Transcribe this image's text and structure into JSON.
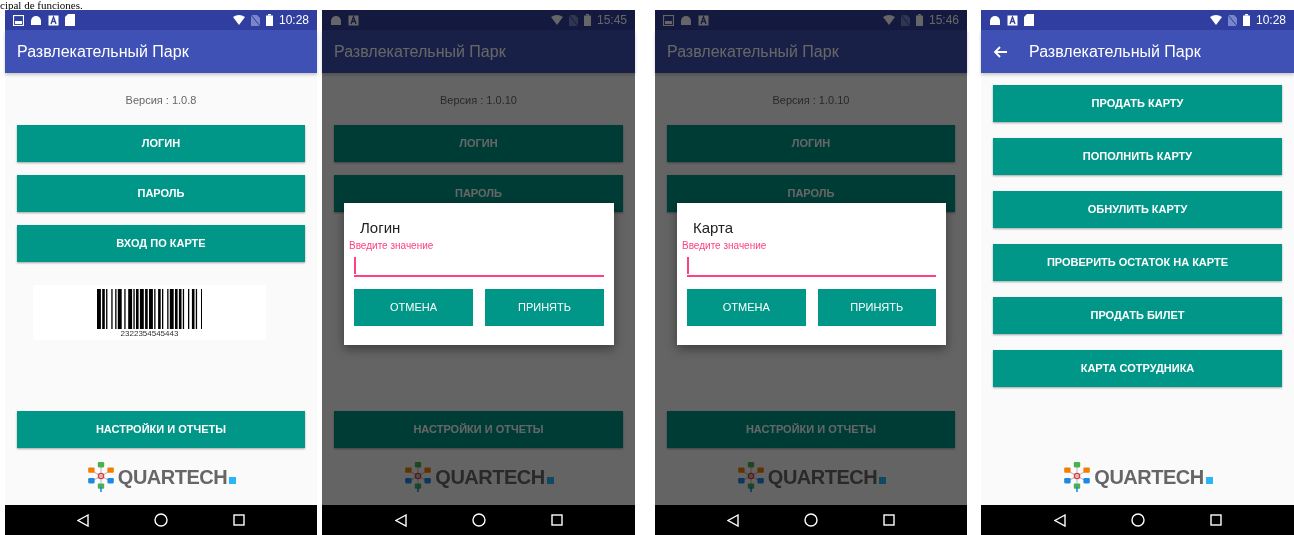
{
  "caption": "cipal de funciones.",
  "phones": [
    {
      "status_bar": {
        "notifications": [
          {
            "kind": "image"
          },
          {
            "kind": "android"
          },
          {
            "kind": "letter"
          },
          {
            "kind": "sd"
          }
        ],
        "time": "10:28"
      },
      "app_bar": {
        "title": "Развлекательный Парк",
        "back": false
      },
      "screen": {
        "kind": "home",
        "version": "Версия : 1.0.8",
        "buttons": [
          "ЛОГИН",
          "ПАРОЛЬ",
          "ВХОД ПО КАРТЕ"
        ],
        "barcode": "2322354545443",
        "settings_button": "НАСТРОЙКИ И ОТЧЕТЫ",
        "logo": "QUARTECH"
      },
      "dimmed": false
    },
    {
      "status_bar": {
        "notifications": [
          {
            "kind": "android"
          },
          {
            "kind": "letter"
          }
        ],
        "time": "15:45"
      },
      "app_bar": {
        "title": "Развлекательный Парк",
        "back": false
      },
      "screen": {
        "kind": "home",
        "version": "Версия : 1.0.10",
        "buttons": [
          "ЛОГИН",
          "ПАРОЛЬ"
        ],
        "settings_button": "НАСТРОЙКИ И ОТЧЕТЫ",
        "logo": "QUARTECH"
      },
      "dimmed": true,
      "dialog": {
        "title": "Логин",
        "label": "Введите значение",
        "buttons": [
          "ОТМЕНА",
          "ПРИНЯТЬ"
        ]
      }
    },
    {
      "status_bar": {
        "notifications": [
          {
            "kind": "image"
          },
          {
            "kind": "android"
          },
          {
            "kind": "letter"
          }
        ],
        "time": "15:46"
      },
      "app_bar": {
        "title": "Развлекательный Парк",
        "back": false
      },
      "screen": {
        "kind": "home",
        "version": "Версия : 1.0.10",
        "buttons": [
          "ЛОГИН",
          "ПАРОЛЬ"
        ],
        "settings_button": "НАСТРОЙКИ И ОТЧЕТЫ",
        "logo": "QUARTECH"
      },
      "dimmed": true,
      "dialog": {
        "title": "Карта",
        "label": "Введите значение",
        "buttons": [
          "ОТМЕНА",
          "ПРИНЯТЬ"
        ]
      }
    },
    {
      "status_bar": {
        "notifications": [
          {
            "kind": "android"
          },
          {
            "kind": "letter"
          },
          {
            "kind": "sd"
          }
        ],
        "time": "10:28"
      },
      "app_bar": {
        "title": "Развлекательный Парк",
        "back": true
      },
      "screen": {
        "kind": "menu",
        "buttons": [
          "ПРОДАТЬ КАРТУ",
          "ПОПОЛНИТЬ КАРТУ",
          "ОБНУЛИТЬ КАРТУ",
          "ПРОВЕРИТЬ ОСТАТОК НА КАРТЕ",
          "ПРОДАТЬ БИЛЕТ",
          "КАРТА СОТРУДНИКА"
        ],
        "logo": "QUARTECH"
      },
      "dimmed": false
    }
  ]
}
